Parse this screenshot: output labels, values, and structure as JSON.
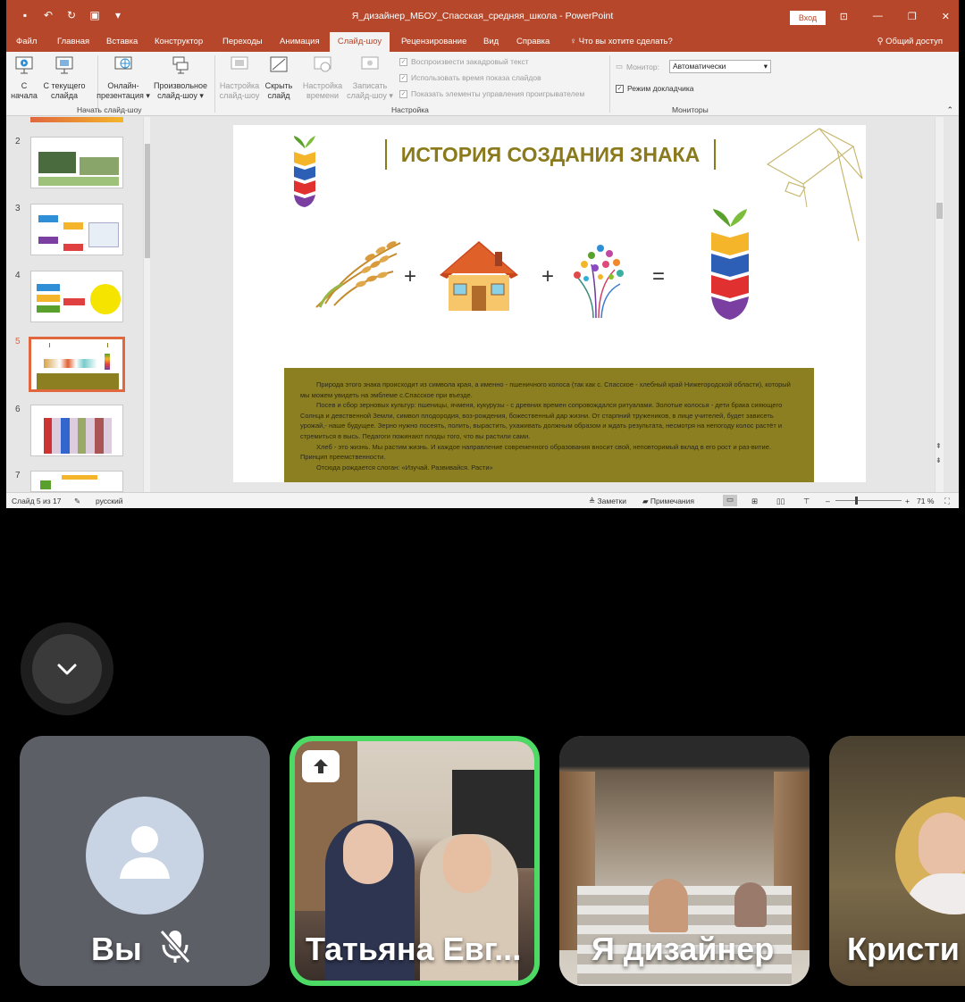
{
  "window": {
    "doc_title": "Я_дизайнер_МБОУ_Спасская_средняя_школа  -  PowerPoint",
    "signin": "Вход"
  },
  "tabs": [
    "Файл",
    "Главная",
    "Вставка",
    "Конструктор",
    "Переходы",
    "Анимация",
    "Слайд-шоу",
    "Рецензирование",
    "Вид",
    "Справка"
  ],
  "active_tab": "Слайд-шоу",
  "tell_me": "Что вы хотите сделать?",
  "share": "Общий доступ",
  "ribbon": {
    "from_start_1": "С",
    "from_start_2": "начала",
    "from_current_1": "С текущего",
    "from_current_2": "слайда",
    "online_1": "Онлайн-",
    "online_2": "презентация ▾",
    "custom_1": "Произвольное",
    "custom_2": "слайд-шоу ▾",
    "group_start": "Начать слайд-шоу",
    "setup_1": "Настройка",
    "setup_2": "слайд-шоу",
    "hide_1": "Скрыть",
    "hide_2": "слайд",
    "timing_1": "Настройка",
    "timing_2": "времени",
    "record_1": "Записать",
    "record_2": "слайд-шоу ▾",
    "chk_narration": "Воспроизвести закадровый текст",
    "chk_timings": "Использовать время показа слайдов",
    "chk_controls": "Показать элементы управления проигрывателем",
    "group_setup": "Настройка",
    "monitor_label": "Монитор:",
    "monitor_value": "Автоматически",
    "presenter_view": "Режим докладчика",
    "group_monitors": "Мониторы"
  },
  "thumbnails": [
    "2",
    "3",
    "4",
    "5",
    "6",
    "7"
  ],
  "active_slide": "5",
  "slide": {
    "title": "ИСТОРИЯ СОЗДАНИЯ ЗНАКА",
    "plus1": "+",
    "plus2": "+",
    "equals": "=",
    "paragraphs": [
      "Природа этого знака происходит из символа края, а именно - пшеничного колоса (так как с. Спасское - хлебный край Нижегородской области), который мы можем увидеть на эмблеме с.Спасское при въезде.",
      "Посев и сбор зерновых культур: пшеницы, ячменя, кукурузы - с древних времен сопровождался ритуалами. Золотые колосья - дети брака сияющего Солнца и девственной Земли, символ плодородия, воз-рождения, божественный дар жизни. От старпний тружеников, в лице учителей, будет зависеть урожай,- наше будущее. Зерно нужно посеять, полить, вырастить, ухаживать должным образом и ждать результата, несмотря на непогоду колос растёт и стремиться в высь. Педагоги пожинают плоды того, что вы растили сами.",
      "Хлеб - это жизнь. Мы растим жизнь. И каждое направление современного образования вносит свой, неповторимый вклад в его рост и раз-витие. Принцип преемственности.",
      "Отсюда рождается слоган: «Изучай. Развивайся. Расти»"
    ]
  },
  "status": {
    "slide_of": "Слайд 5 из 17",
    "language": "русский",
    "notes": "Заметки",
    "comments": "Примечания",
    "zoom": "71 %"
  },
  "tiles": [
    {
      "name": "Вы"
    },
    {
      "name": "Татьяна Евг..."
    },
    {
      "name": "Я дизайнер"
    },
    {
      "name": "Кристи"
    }
  ],
  "colors": {
    "ppt_red": "#b7472a",
    "olive": "#8c7f22",
    "active_speaker": "#4cd964"
  }
}
